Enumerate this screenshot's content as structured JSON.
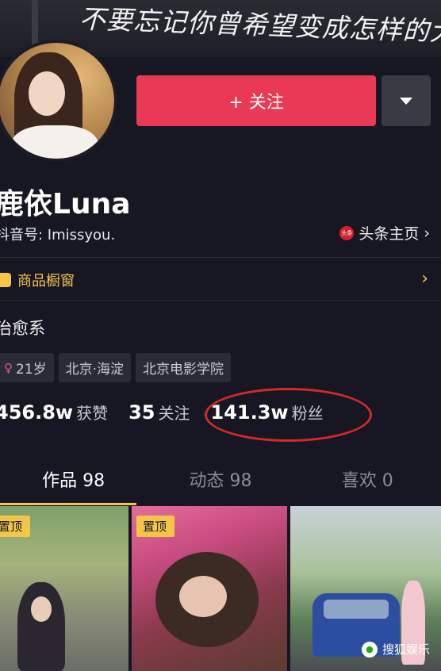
{
  "banner": {
    "text": "不要忘记你曾希望变成怎样的大人"
  },
  "profile": {
    "follow_label": "+ 关注",
    "name": "鹿依Luna",
    "douyin_id": "抖音号: Imissyou.",
    "toutiao_label": "头条主页",
    "toutiao_chevron": "›",
    "toutiao_logo_text": "头条",
    "shop_label": "商品橱窗",
    "shop_chevron": "›",
    "bio": "治愈系",
    "tags": [
      {
        "label": "21岁",
        "icon": "female-icon"
      },
      {
        "label": "北京·海淀"
      },
      {
        "label": "北京电影学院"
      }
    ]
  },
  "stats": [
    {
      "number": "456.8w",
      "label": "获赞"
    },
    {
      "number": "35",
      "label": "关注"
    },
    {
      "number": "141.3w",
      "label": "粉丝"
    }
  ],
  "tabs": [
    {
      "label": "作品 98",
      "active": true
    },
    {
      "label": "动态 98",
      "active": false
    },
    {
      "label": "喜欢 0",
      "active": false
    }
  ],
  "videos": [
    {
      "pin_label": "置顶"
    },
    {
      "pin_label": "置顶"
    },
    {
      "pin_label": ""
    }
  ],
  "watermark": {
    "label": "搜狐娱乐"
  },
  "colors": {
    "background": "#161722",
    "follow_button": "#e83a56",
    "accent_gold": "#f3c64a",
    "highlight_circle": "#d52828"
  }
}
